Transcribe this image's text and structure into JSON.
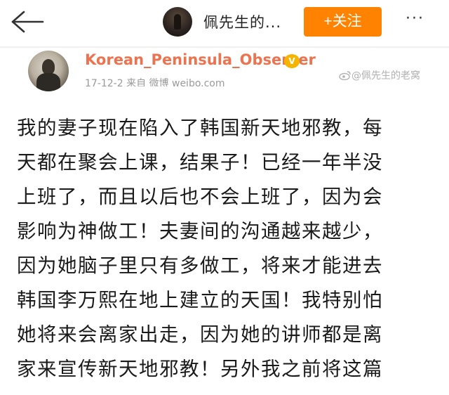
{
  "topbar": {
    "title": "佩先生的...",
    "follow_label": "+关注",
    "more_label": "···"
  },
  "post": {
    "username": "Korean_Peninsula_Observer",
    "meta": "17-12-2  来自 微博 weibo.com",
    "watermark": "@佩先生的老窝",
    "lines": [
      "我的妻子现在陷入了韩国新天地邪教，每",
      "天都在聚会上课，结果子！已经一年半没",
      "上班了，而且以后也不会上班了，因为会",
      "影响为神做工！夫妻间的沟通越来越少，",
      "因为她脑子里只有多做工，将来才能进去",
      "韩国李万熙在地上建立的天国！我特别怕",
      "她将来会离家出走，因为她的讲师都是离",
      "家来宣传新天地邪教！另外我之前将这篇"
    ]
  },
  "colors": {
    "follow_button": "#ff8200",
    "username": "#eb7350"
  },
  "icons": {
    "back": "back-arrow-icon",
    "verified": "verified-badge-icon",
    "weibo_logo": "weibo-logo-icon"
  }
}
